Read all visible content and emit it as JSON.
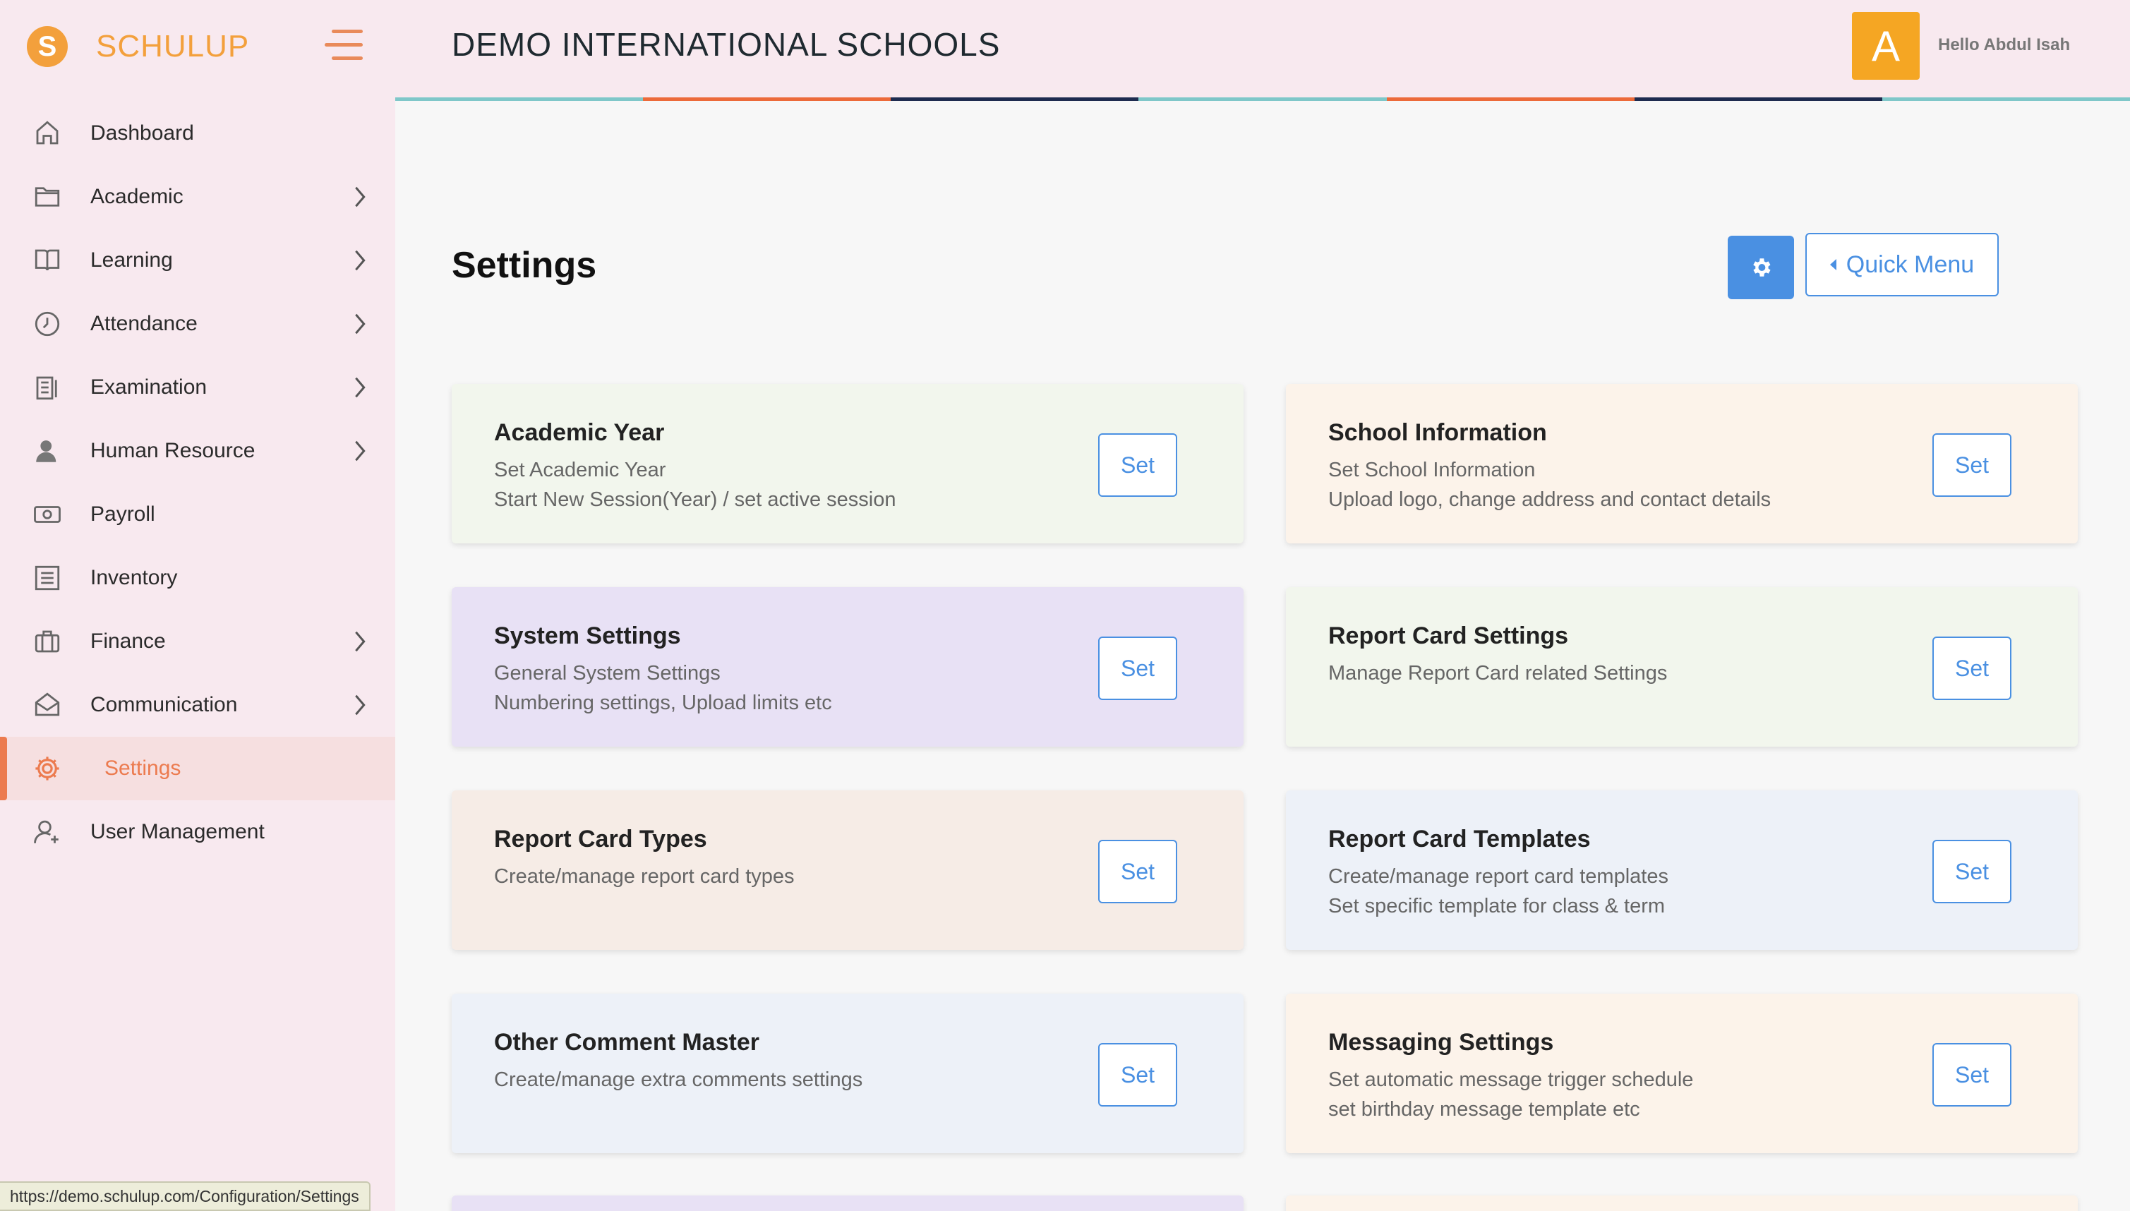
{
  "brand": {
    "logo_letter": "S",
    "name": "SCHULUP"
  },
  "sidebar": {
    "items": [
      {
        "label": "Dashboard",
        "icon": "home-icon",
        "chevron": false,
        "active": false
      },
      {
        "label": "Academic",
        "icon": "folder-icon",
        "chevron": true,
        "active": false
      },
      {
        "label": "Learning",
        "icon": "book-icon",
        "chevron": true,
        "active": false
      },
      {
        "label": "Attendance",
        "icon": "clock-icon",
        "chevron": true,
        "active": false
      },
      {
        "label": "Examination",
        "icon": "clipboard-icon",
        "chevron": true,
        "active": false
      },
      {
        "label": "Human Resource",
        "icon": "person-icon",
        "chevron": true,
        "active": false
      },
      {
        "label": "Payroll",
        "icon": "money-icon",
        "chevron": false,
        "active": false
      },
      {
        "label": "Inventory",
        "icon": "list-icon",
        "chevron": false,
        "active": false
      },
      {
        "label": "Finance",
        "icon": "briefcase-icon",
        "chevron": true,
        "active": false
      },
      {
        "label": "Communication",
        "icon": "mail-open-icon",
        "chevron": true,
        "active": false
      },
      {
        "label": "Settings",
        "icon": "gear-icon",
        "chevron": false,
        "active": true
      },
      {
        "label": "User Management",
        "icon": "user-add-icon",
        "chevron": false,
        "active": false
      }
    ]
  },
  "header": {
    "school_name": "DEMO INTERNATIONAL SCHOOLS",
    "avatar_letter": "A",
    "greeting": "Hello Abdul Isah",
    "bar_colors": [
      "#7fc7c9",
      "#ec6a3a",
      "#1e2b4f",
      "#7fc7c9",
      "#ec6a3a",
      "#1e2b4f",
      "#7fc7c9"
    ]
  },
  "main": {
    "title": "Settings",
    "quick_menu_label": "Quick Menu",
    "set_label": "Set",
    "cards": [
      {
        "title": "Academic Year",
        "lines": [
          "Set Academic Year",
          "Start New Session(Year) / set active session"
        ],
        "bg": "#f2f6ed"
      },
      {
        "title": "School Information",
        "lines": [
          "Set School Information",
          "Upload logo, change address and contact details"
        ],
        "bg": "#fcf3ea"
      },
      {
        "title": "System Settings",
        "lines": [
          "General System Settings",
          "Numbering settings, Upload limits etc"
        ],
        "bg": "#e8e1f5"
      },
      {
        "title": "Report Card Settings",
        "lines": [
          "Manage Report Card related Settings"
        ],
        "bg": "#f2f6ed"
      },
      {
        "title": "Report Card Types",
        "lines": [
          "Create/manage report card types"
        ],
        "bg": "#f6ece6"
      },
      {
        "title": "Report Card Templates",
        "lines": [
          "Create/manage report card templates",
          "Set specific template for class & term"
        ],
        "bg": "#edf1f8"
      },
      {
        "title": "Other Comment Master",
        "lines": [
          "Create/manage extra comments settings"
        ],
        "bg": "#edf1f8"
      },
      {
        "title": "Messaging Settings",
        "lines": [
          "Set automatic message trigger schedule",
          "set birthday message template etc"
        ],
        "bg": "#fcf3ea"
      }
    ]
  },
  "status_url": "https://demo.schulup.com/Configuration/Settings"
}
